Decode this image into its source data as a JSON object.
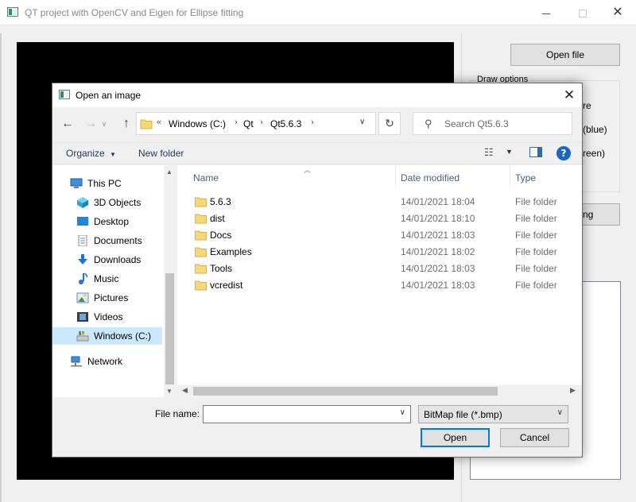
{
  "main_window": {
    "title": "QT project with OpenCV and Eigen for Ellipse fitting",
    "open_file_label": "Open file",
    "draw_options_label": "Draw options",
    "opt_fragment_1": "re",
    "opt_fragment_2": "(blue)",
    "opt_fragment_3": "reen)",
    "side_button_fragment": "ng"
  },
  "dialog": {
    "title": "Open an image",
    "breadcrumb": {
      "overflow": "«",
      "items": [
        "Windows (C:)",
        "Qt",
        "Qt5.6.3"
      ]
    },
    "search_placeholder": "Search Qt5.6.3",
    "toolbar": {
      "organize_label": "Organize",
      "new_folder_label": "New folder",
      "help_label": "?"
    },
    "nav_items": [
      {
        "label": "This PC",
        "icon": "pc-icon"
      },
      {
        "label": "3D Objects",
        "icon": "3d-objects-icon"
      },
      {
        "label": "Desktop",
        "icon": "desktop-icon"
      },
      {
        "label": "Documents",
        "icon": "documents-icon"
      },
      {
        "label": "Downloads",
        "icon": "downloads-icon"
      },
      {
        "label": "Music",
        "icon": "music-icon"
      },
      {
        "label": "Pictures",
        "icon": "pictures-icon"
      },
      {
        "label": "Videos",
        "icon": "videos-icon"
      },
      {
        "label": "Windows (C:)",
        "icon": "drive-icon"
      },
      {
        "label": "Network",
        "icon": "network-icon"
      }
    ],
    "columns": {
      "name": "Name",
      "date_modified": "Date modified",
      "type": "Type"
    },
    "files": [
      {
        "name": "5.6.3",
        "date": "14/01/2021 18:04",
        "type": "File folder"
      },
      {
        "name": "dist",
        "date": "14/01/2021 18:10",
        "type": "File folder"
      },
      {
        "name": "Docs",
        "date": "14/01/2021 18:03",
        "type": "File folder"
      },
      {
        "name": "Examples",
        "date": "14/01/2021 18:02",
        "type": "File folder"
      },
      {
        "name": "Tools",
        "date": "14/01/2021 18:03",
        "type": "File folder"
      },
      {
        "name": "vcredist",
        "date": "14/01/2021 18:03",
        "type": "File folder"
      }
    ],
    "file_name_label": "File name:",
    "file_name_value": "",
    "file_type_value": "BitMap file (*.bmp)",
    "open_label": "Open",
    "cancel_label": "Cancel"
  },
  "colors": {
    "accent": "#0078d7",
    "selection": "#cce8ff",
    "folder": "#f8d775"
  }
}
